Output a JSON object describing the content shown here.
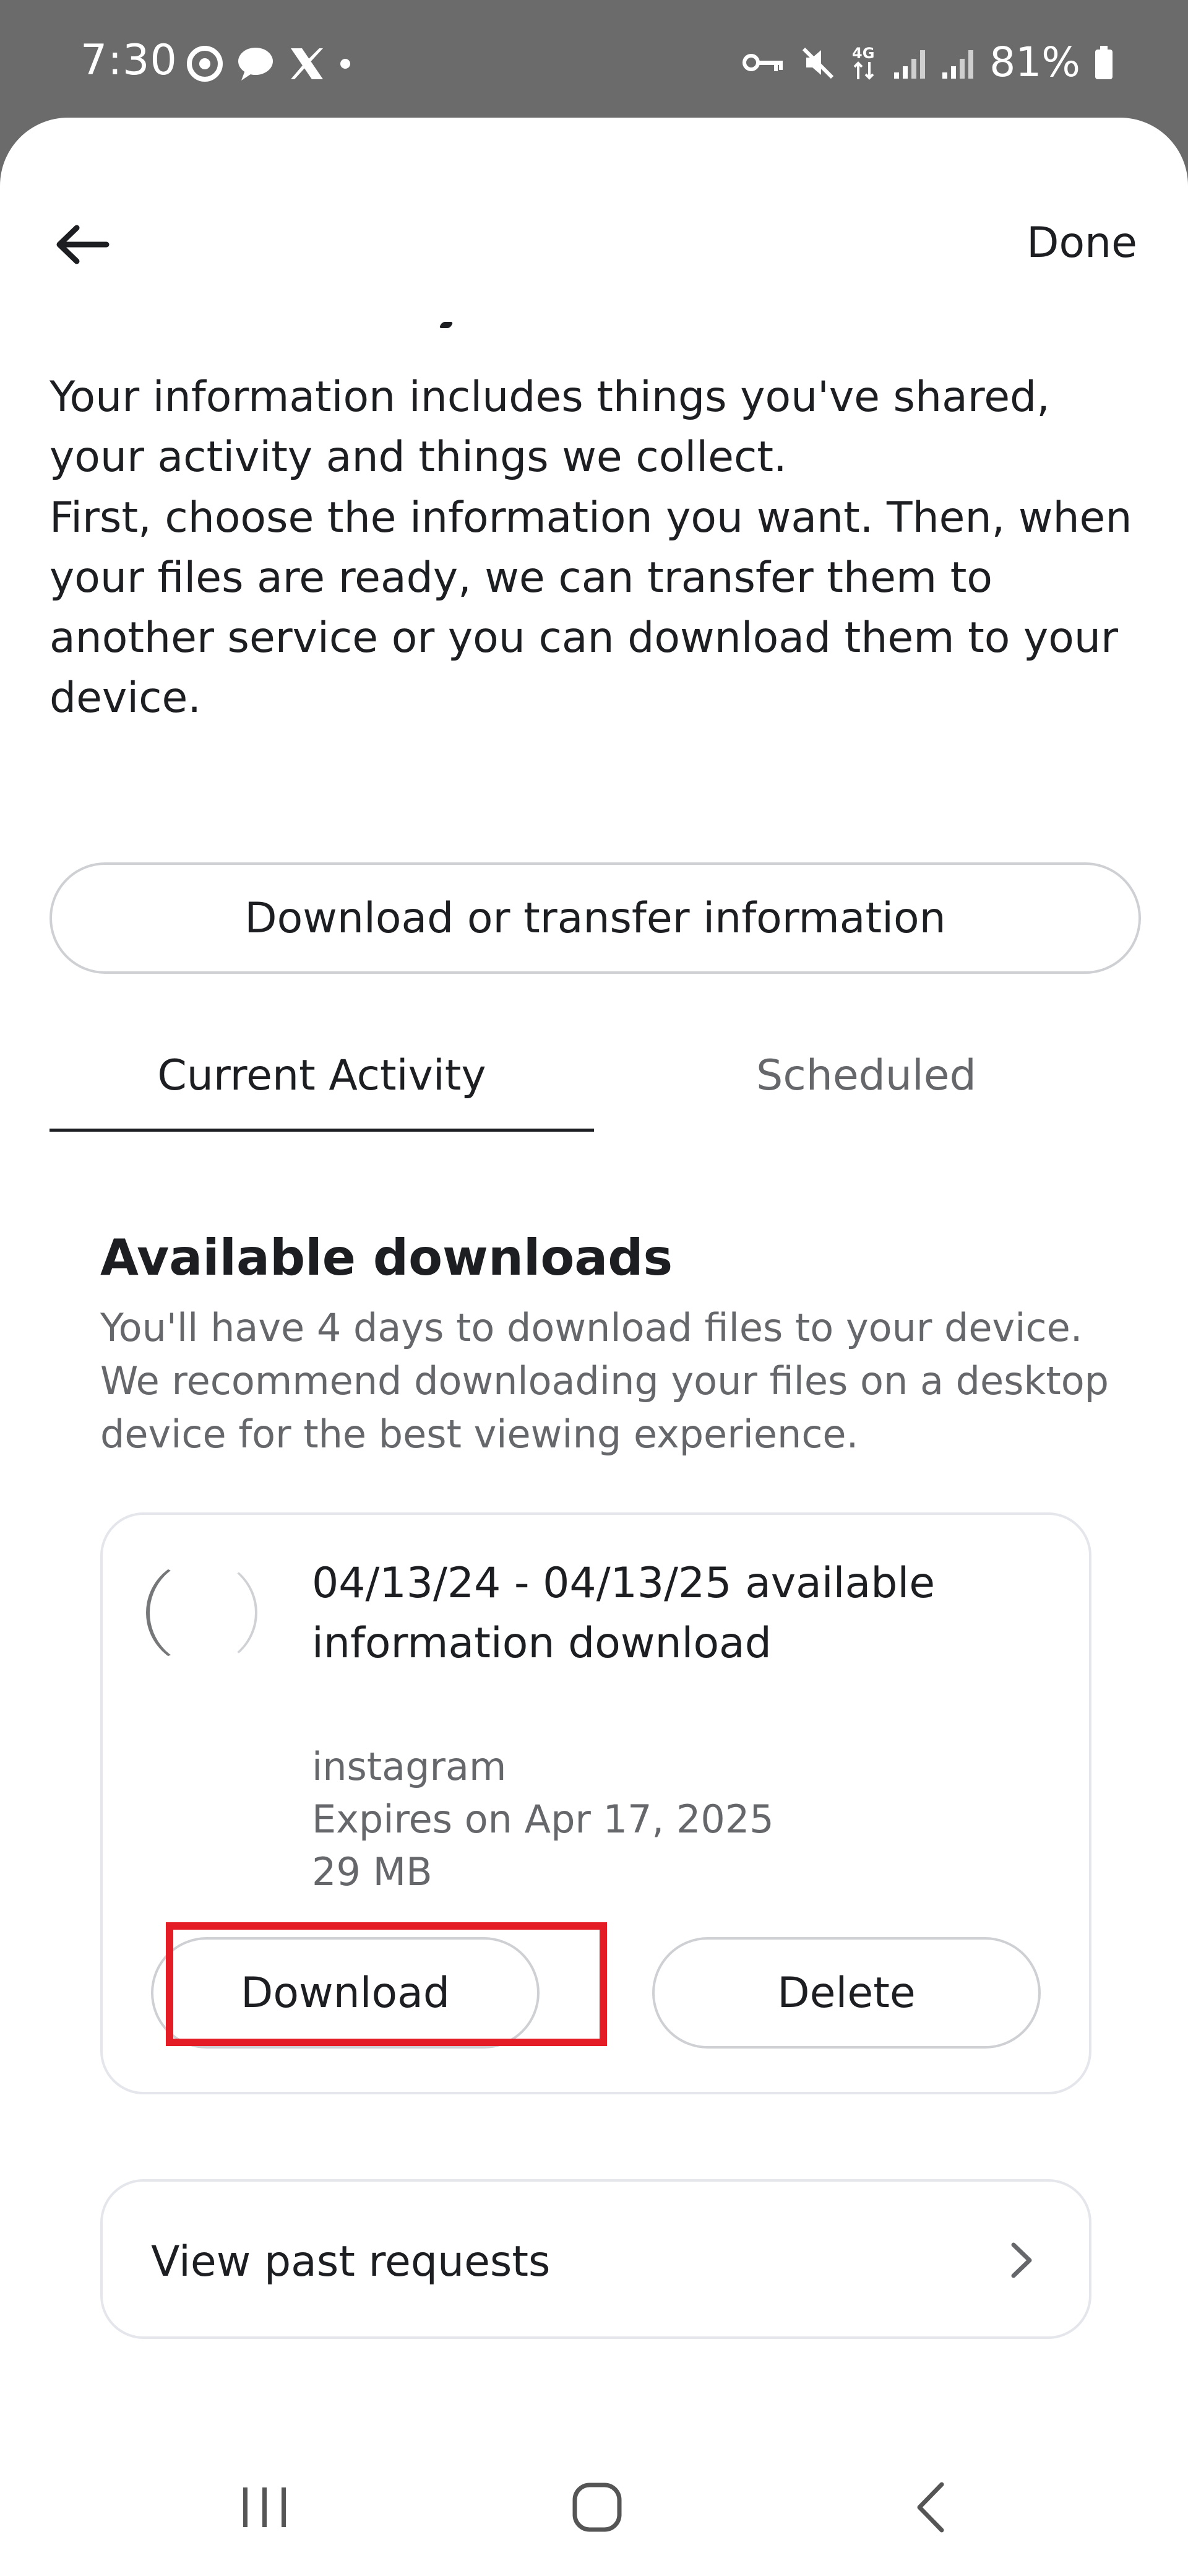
{
  "status_bar": {
    "time": "7:30",
    "battery": "81%",
    "icons": [
      "chrome-icon",
      "chat-icon",
      "x-icon",
      "notification-dot-icon",
      "vpn-key-icon",
      "mute-icon",
      "4g-icon",
      "signal-icon",
      "signal-icon",
      "battery-icon"
    ]
  },
  "header": {
    "done_label": "Done",
    "back_icon": "back-arrow-icon"
  },
  "intro": {
    "paragraph_1": "Your information includes things you've shared, your activity and things we collect.",
    "paragraph_2": "First, choose the information you want. Then, when your files are ready, we can transfer them to another service or you can download them to your device."
  },
  "primary_button": {
    "label": "Download or transfer information"
  },
  "tabs": [
    {
      "label": "Current Activity",
      "active": true
    },
    {
      "label": "Scheduled",
      "active": false
    }
  ],
  "available_downloads": {
    "title": "Available downloads",
    "description": "You'll have 4 days to download files to your device. We recommend downloading your files on a desktop device for the best viewing experience.",
    "card": {
      "title": "04/13/24 - 04/13/25 available information download",
      "app": "instagram",
      "expires": "Expires on Apr 17, 2025",
      "size": "29 MB",
      "download_label": "Download",
      "delete_label": "Delete"
    }
  },
  "past_requests": {
    "label": "View past requests"
  },
  "colors": {
    "text_primary": "#1c1e21",
    "text_secondary": "#65676b",
    "border": "#ced0d4",
    "highlight": "#e31c25",
    "status_bar_bg": "#6b6b6b"
  }
}
